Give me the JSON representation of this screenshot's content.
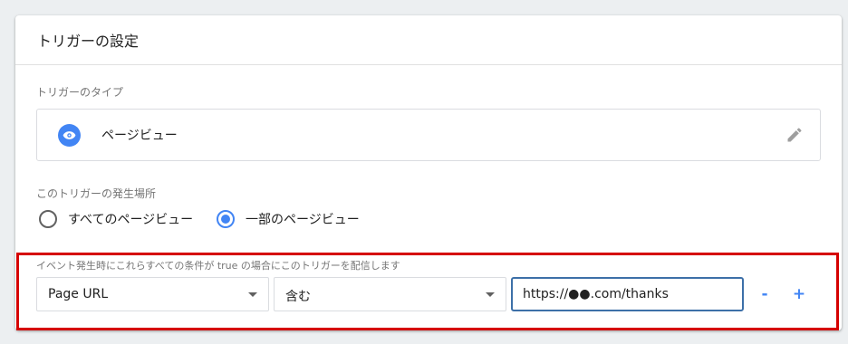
{
  "header": {
    "title": "トリガーの設定"
  },
  "trigger_type": {
    "section_label": "トリガーのタイプ",
    "name": "ページビュー",
    "icon": "eye-icon",
    "icon_color": "#4285f4"
  },
  "fire_on": {
    "section_label": "このトリガーの発生場所",
    "options": [
      {
        "label": "すべてのページビュー",
        "checked": false
      },
      {
        "label": "一部のページビュー",
        "checked": true
      }
    ]
  },
  "condition": {
    "label": "イベント発生時にこれらすべての条件が true の場合にこのトリガーを配信します",
    "variable": "Page URL",
    "operator": "含む",
    "value": "https://●●.com/thanks",
    "remove_label": "-",
    "add_label": "+"
  },
  "colors": {
    "accent": "#4285f4",
    "highlight_border": "#d50000",
    "input_focus_border": "#3d70a8"
  }
}
